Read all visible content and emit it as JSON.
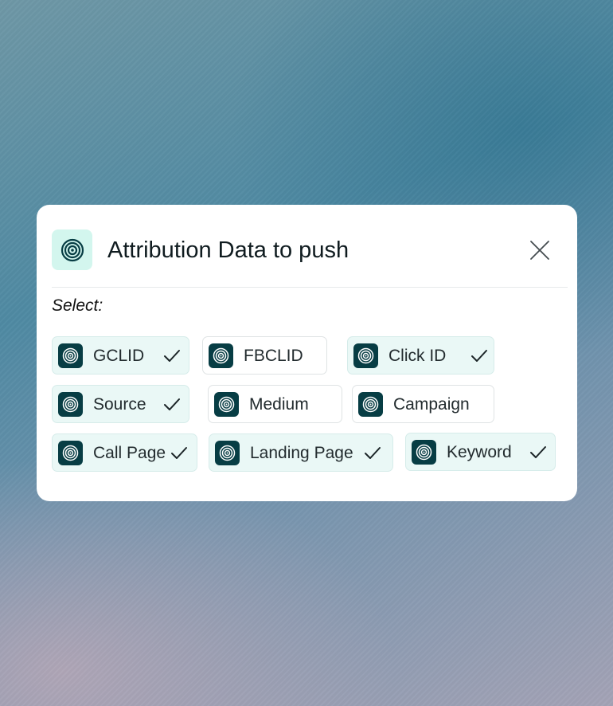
{
  "modal": {
    "title": "Attribution Data to push",
    "header_icon": "target-rings-icon",
    "close_icon": "close-icon",
    "select_label": "Select:"
  },
  "colors": {
    "accent_dark": "#073d44",
    "accent_light": "#d3f6ee",
    "chip_selected_bg": "#eaf8f6"
  },
  "options": [
    {
      "label": "GCLID",
      "selected": true
    },
    {
      "label": "FBCLID",
      "selected": false
    },
    {
      "label": "Click ID",
      "selected": true
    },
    {
      "label": "Source",
      "selected": true
    },
    {
      "label": "Medium",
      "selected": false
    },
    {
      "label": "Campaign",
      "selected": false
    },
    {
      "label": "Call Page",
      "selected": true
    },
    {
      "label": "Landing Page",
      "selected": true
    },
    {
      "label": "Keyword",
      "selected": true
    }
  ]
}
